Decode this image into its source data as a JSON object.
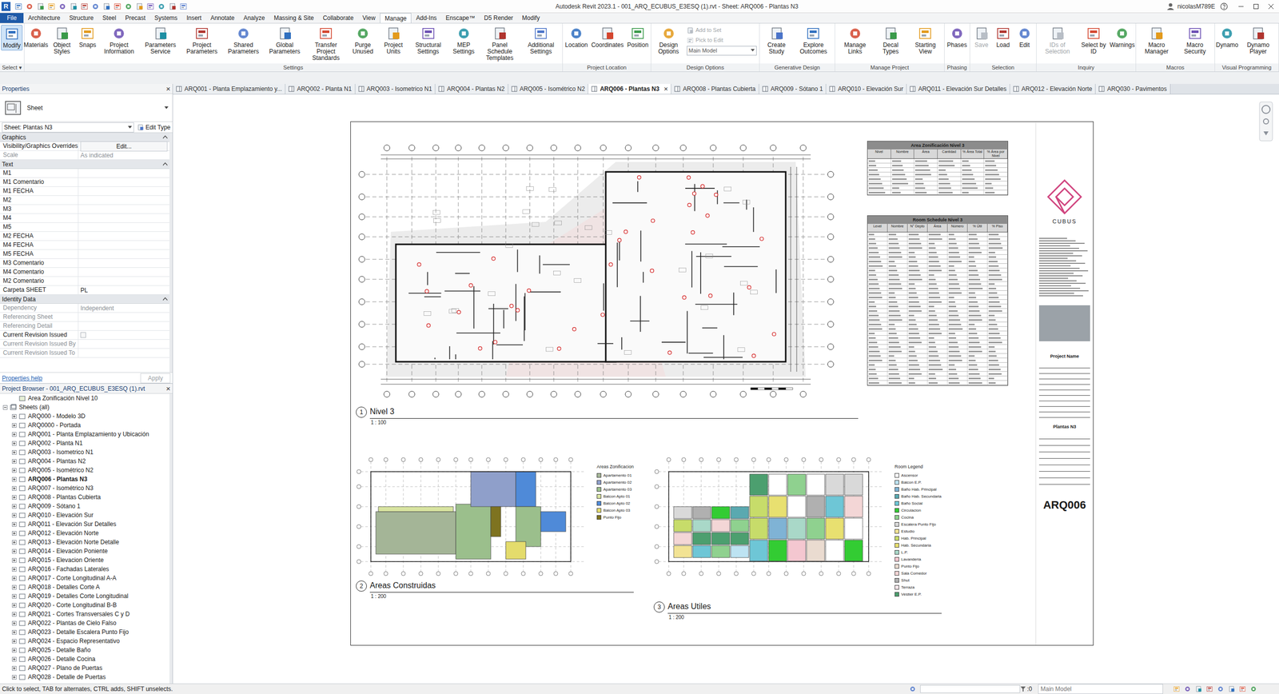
{
  "window": {
    "title": "Autodesk Revit 2023.1 - 001_ARQ_ECUBUS_E3ESQ (1).rvt - Sheet: ARQ006 - Plantas N3",
    "user": "nicolasM789E",
    "app_logo": "R"
  },
  "ribbon_tabs": [
    {
      "label": "File",
      "selected": false
    },
    {
      "label": "Architecture",
      "selected": false
    },
    {
      "label": "Structure",
      "selected": false
    },
    {
      "label": "Steel",
      "selected": false
    },
    {
      "label": "Precast",
      "selected": false
    },
    {
      "label": "Systems",
      "selected": false
    },
    {
      "label": "Insert",
      "selected": false
    },
    {
      "label": "Annotate",
      "selected": false
    },
    {
      "label": "Analyze",
      "selected": false
    },
    {
      "label": "Massing & Site",
      "selected": false
    },
    {
      "label": "Collaborate",
      "selected": false
    },
    {
      "label": "View",
      "selected": false
    },
    {
      "label": "Manage",
      "selected": true
    },
    {
      "label": "Add-Ins",
      "selected": false
    },
    {
      "label": "Enscape™",
      "selected": false
    },
    {
      "label": "D5 Render",
      "selected": false
    },
    {
      "label": "Modify",
      "selected": false
    }
  ],
  "ribbon_groups": [
    {
      "label": "Select ▾",
      "buttons": [
        {
          "label": "Modify",
          "kind": "large",
          "selected": true,
          "disabled": false
        }
      ]
    },
    {
      "label": "Settings",
      "buttons": [
        {
          "label": "Materials",
          "kind": "large",
          "selected": false,
          "disabled": false
        },
        {
          "label": "Object Styles",
          "kind": "large",
          "selected": false,
          "disabled": false
        },
        {
          "label": "Snaps",
          "kind": "large",
          "selected": false,
          "disabled": false
        },
        {
          "label": "Project Information",
          "kind": "large",
          "selected": false,
          "disabled": false
        },
        {
          "label": "Parameters Service",
          "kind": "large",
          "selected": false,
          "disabled": false
        },
        {
          "label": "Project Parameters",
          "kind": "large",
          "selected": false,
          "disabled": false
        },
        {
          "label": "Shared Parameters",
          "kind": "large",
          "selected": false,
          "disabled": false
        },
        {
          "label": "Global Parameters",
          "kind": "large",
          "selected": false,
          "disabled": false
        },
        {
          "label": "Transfer Project Standards",
          "kind": "large",
          "selected": false,
          "disabled": false
        },
        {
          "label": "Purge Unused",
          "kind": "large",
          "selected": false,
          "disabled": false
        },
        {
          "label": "Project Units",
          "kind": "large",
          "selected": false,
          "disabled": false
        },
        {
          "label": "Structural Settings",
          "kind": "large",
          "selected": false,
          "disabled": false
        },
        {
          "label": "MEP Settings",
          "kind": "large",
          "selected": false,
          "disabled": false
        },
        {
          "label": "Panel Schedule Templates",
          "kind": "large",
          "selected": false,
          "disabled": false
        },
        {
          "label": "Additional Settings",
          "kind": "large",
          "selected": false,
          "disabled": false
        }
      ]
    },
    {
      "label": "Project Location",
      "buttons": [
        {
          "label": "Location",
          "kind": "large",
          "selected": false,
          "disabled": false
        },
        {
          "label": "Coordinates",
          "kind": "large",
          "selected": false,
          "disabled": false
        },
        {
          "label": "Position",
          "kind": "large",
          "selected": false,
          "disabled": false
        }
      ]
    },
    {
      "label": "Design Options",
      "buttons": [
        {
          "label": "Design Options",
          "kind": "large",
          "selected": false,
          "disabled": false
        },
        {
          "label": "Add to Set",
          "kind": "small",
          "selected": false,
          "disabled": true
        },
        {
          "label": "Pick to Edit",
          "kind": "small",
          "selected": false,
          "disabled": true
        },
        {
          "label": "Main Model",
          "kind": "dropdown",
          "selected": false,
          "disabled": false
        }
      ]
    },
    {
      "label": "Generative Design",
      "buttons": [
        {
          "label": "Create Study",
          "kind": "large",
          "selected": false,
          "disabled": false
        },
        {
          "label": "Explore Outcomes",
          "kind": "large",
          "selected": false,
          "disabled": false
        }
      ]
    },
    {
      "label": "Manage Project",
      "buttons": [
        {
          "label": "Manage Links",
          "kind": "large",
          "selected": false,
          "disabled": false
        },
        {
          "label": "Decal Types",
          "kind": "large",
          "selected": false,
          "disabled": false
        },
        {
          "label": "Starting View",
          "kind": "large",
          "selected": false,
          "disabled": false
        }
      ]
    },
    {
      "label": "Phasing",
      "buttons": [
        {
          "label": "Phases",
          "kind": "large",
          "selected": false,
          "disabled": false
        }
      ]
    },
    {
      "label": "Selection",
      "buttons": [
        {
          "label": "Save",
          "kind": "large",
          "selected": false,
          "disabled": true
        },
        {
          "label": "Load",
          "kind": "large",
          "selected": false,
          "disabled": false
        },
        {
          "label": "Edit",
          "kind": "large",
          "selected": false,
          "disabled": false
        }
      ]
    },
    {
      "label": "Inquiry",
      "buttons": [
        {
          "label": "IDs of Selection",
          "kind": "large",
          "selected": false,
          "disabled": true
        },
        {
          "label": "Select by ID",
          "kind": "large",
          "selected": false,
          "disabled": false
        },
        {
          "label": "Warnings",
          "kind": "large",
          "selected": false,
          "disabled": false
        }
      ]
    },
    {
      "label": "Macros",
      "buttons": [
        {
          "label": "Macro Manager",
          "kind": "large",
          "selected": false,
          "disabled": false
        },
        {
          "label": "Macro Security",
          "kind": "large",
          "selected": false,
          "disabled": false
        }
      ]
    },
    {
      "label": "Visual Programming",
      "buttons": [
        {
          "label": "Dynamo",
          "kind": "large",
          "selected": false,
          "disabled": false
        },
        {
          "label": "Dynamo Player",
          "kind": "large",
          "selected": false,
          "disabled": false
        }
      ]
    }
  ],
  "view_tabs": [
    {
      "label": "ARQ001 - Planta Emplazamiento y...",
      "selected": false
    },
    {
      "label": "ARQ002 - Planta N1",
      "selected": false
    },
    {
      "label": "ARQ003 - Isometrico N1",
      "selected": false
    },
    {
      "label": "ARQ004 - Plantas N2",
      "selected": false
    },
    {
      "label": "ARQ005 - Isométrico N2",
      "selected": false
    },
    {
      "label": "ARQ006 - Plantas N3",
      "selected": true,
      "close": "×"
    },
    {
      "label": "ARQ008 - Plantas Cubierta",
      "selected": false
    },
    {
      "label": "ARQ009 - Sótano 1",
      "selected": false
    },
    {
      "label": "ARQ010 - Elevación Sur",
      "selected": false
    },
    {
      "label": "ARQ011 - Elevación Sur Detalles",
      "selected": false
    },
    {
      "label": "ARQ012 - Elevación Norte",
      "selected": false
    },
    {
      "label": "ARQ030 - Pavimentos",
      "selected": false
    }
  ],
  "properties": {
    "title": "Properties",
    "close": "×",
    "type_name": "Sheet",
    "instance": "Sheet: Plantas N3",
    "edit_type": "Edit Type",
    "sections": [
      {
        "label": "Graphics",
        "expanded": true,
        "rows": [
          {
            "name": "Visibility/Graphics Overrides",
            "value": "Edit...",
            "kind": "button"
          },
          {
            "name": "Scale",
            "value": "As indicated",
            "kind": "readonly"
          }
        ]
      },
      {
        "label": "Text",
        "expanded": true,
        "rows": [
          {
            "name": "M1",
            "value": "",
            "kind": "field"
          },
          {
            "name": "M1 Comentario",
            "value": "",
            "kind": "field"
          },
          {
            "name": "M1 FECHA",
            "value": "",
            "kind": "field"
          },
          {
            "name": "M2",
            "value": "",
            "kind": "field"
          },
          {
            "name": "M3",
            "value": "",
            "kind": "field"
          },
          {
            "name": "M4",
            "value": "",
            "kind": "field"
          },
          {
            "name": "M5",
            "value": "",
            "kind": "field"
          },
          {
            "name": "M2 FECHA",
            "value": "",
            "kind": "field"
          },
          {
            "name": "M4 FECHA",
            "value": "",
            "kind": "field"
          },
          {
            "name": "M5 FECHA",
            "value": "",
            "kind": "field"
          },
          {
            "name": "M3 Comentario",
            "value": "",
            "kind": "field"
          },
          {
            "name": "M4 Comentario",
            "value": "",
            "kind": "field"
          },
          {
            "name": "M2 Comentario",
            "value": "",
            "kind": "field"
          },
          {
            "name": "Carpeta SHEET",
            "value": "PL",
            "kind": "field"
          }
        ]
      },
      {
        "label": "Identity Data",
        "expanded": true,
        "rows": [
          {
            "name": "Dependency",
            "value": "Independent",
            "kind": "readonly"
          },
          {
            "name": "Referencing Sheet",
            "value": "",
            "kind": "readonly"
          },
          {
            "name": "Referencing Detail",
            "value": "",
            "kind": "readonly"
          },
          {
            "name": "Current Revision Issued",
            "value": "",
            "kind": "checkbox",
            "checked": false
          },
          {
            "name": "Current Revision Issued By",
            "value": "",
            "kind": "readonly"
          },
          {
            "name": "Current Revision Issued To",
            "value": "",
            "kind": "readonly"
          }
        ]
      }
    ],
    "help": "Properties help",
    "apply": "Apply"
  },
  "project_browser": {
    "title": "Project Browser - 001_ARQ_ECUBUS_E3ESQ (1).rvt",
    "close": "×",
    "items": [
      {
        "label": "Area Zonificación Nivel 10",
        "kind": "view",
        "expanded": false,
        "selected": false
      },
      {
        "label": "Sheets (all)",
        "kind": "group",
        "expanded": true,
        "selected": false
      },
      {
        "label": "ARQ000 - Modelo 3D",
        "kind": "sheet",
        "expanded": false,
        "selected": false
      },
      {
        "label": "ARQ0000 - Portada",
        "kind": "sheet",
        "expanded": false,
        "selected": false
      },
      {
        "label": "ARQ001 - Planta Emplazamiento y Ubicación",
        "kind": "sheet",
        "expanded": false,
        "selected": false
      },
      {
        "label": "ARQ002 - Planta N1",
        "kind": "sheet",
        "expanded": false,
        "selected": false
      },
      {
        "label": "ARQ003 - Isometrico N1",
        "kind": "sheet",
        "expanded": false,
        "selected": false
      },
      {
        "label": "ARQ004 - Plantas N2",
        "kind": "sheet",
        "expanded": false,
        "selected": false
      },
      {
        "label": "ARQ005 - Isométrico N2",
        "kind": "sheet",
        "expanded": false,
        "selected": false
      },
      {
        "label": "ARQ006 - Plantas N3",
        "kind": "sheet",
        "expanded": false,
        "selected": true
      },
      {
        "label": "ARQ007 - Isométrico N3",
        "kind": "sheet",
        "expanded": false,
        "selected": false
      },
      {
        "label": "ARQ008 - Plantas Cubierta",
        "kind": "sheet",
        "expanded": false,
        "selected": false
      },
      {
        "label": "ARQ009 - Sótano 1",
        "kind": "sheet",
        "expanded": false,
        "selected": false
      },
      {
        "label": "ARQ010 - Elevación Sur",
        "kind": "sheet",
        "expanded": false,
        "selected": false
      },
      {
        "label": "ARQ011 - Elevación Sur Detalles",
        "kind": "sheet",
        "expanded": false,
        "selected": false
      },
      {
        "label": "ARQ012 - Elevación Norte",
        "kind": "sheet",
        "expanded": false,
        "selected": false
      },
      {
        "label": "ARQ013 - Elevación Norte Detalle",
        "kind": "sheet",
        "expanded": false,
        "selected": false
      },
      {
        "label": "ARQ014 - Elevación Poniente",
        "kind": "sheet",
        "expanded": false,
        "selected": false
      },
      {
        "label": "ARQ015 - Elevacion Oriente",
        "kind": "sheet",
        "expanded": false,
        "selected": false
      },
      {
        "label": "ARQ016 - Fachadas Laterales",
        "kind": "sheet",
        "expanded": false,
        "selected": false
      },
      {
        "label": "ARQ017 - Corte Longitudinal A-A",
        "kind": "sheet",
        "expanded": false,
        "selected": false
      },
      {
        "label": "ARQ018 - Detalles Corte A",
        "kind": "sheet",
        "expanded": false,
        "selected": false
      },
      {
        "label": "ARQ019 - Detalles Corte Longitudinal",
        "kind": "sheet",
        "expanded": false,
        "selected": false
      },
      {
        "label": "ARQ020 - Corte Longitudinal B-B",
        "kind": "sheet",
        "expanded": false,
        "selected": false
      },
      {
        "label": "ARQ021 - Cortes Transversales C y D",
        "kind": "sheet",
        "expanded": false,
        "selected": false
      },
      {
        "label": "ARQ022 - Plantas de Cielo Falso",
        "kind": "sheet",
        "expanded": false,
        "selected": false
      },
      {
        "label": "ARQ023 - Detalle Escalera Punto Fijo",
        "kind": "sheet",
        "expanded": false,
        "selected": false
      },
      {
        "label": "ARQ024 - Espacio Representativo",
        "kind": "sheet",
        "expanded": false,
        "selected": false
      },
      {
        "label": "ARQ025 - Detalle Baño",
        "kind": "sheet",
        "expanded": false,
        "selected": false
      },
      {
        "label": "ARQ026 - Detalle Cocina",
        "kind": "sheet",
        "expanded": false,
        "selected": false
      },
      {
        "label": "ARQ027 - Plano de Puertas",
        "kind": "sheet",
        "expanded": false,
        "selected": false
      },
      {
        "label": "ARQ028 - Detalle de Puertas",
        "kind": "sheet",
        "expanded": false,
        "selected": false
      }
    ]
  },
  "sheet": {
    "viewports": [
      {
        "number": "1",
        "title": "Nivel 3",
        "scale": "1 : 100"
      },
      {
        "number": "2",
        "title": "Areas Construidas",
        "scale": "1 : 200"
      },
      {
        "number": "3",
        "title": "Areas Utiles",
        "scale": "1 : 200"
      }
    ],
    "zone_legend": {
      "title": "Areas Zonificacion",
      "items": [
        {
          "label": "Apartamento 01",
          "color": "#a4b597"
        },
        {
          "label": "Apartamento 02",
          "color": "#8f9fca"
        },
        {
          "label": "Apartamento 03",
          "color": "#9bbf8c"
        },
        {
          "label": "Balcon Apto 01",
          "color": "#d8e4a0"
        },
        {
          "label": "Balcon Apto 02",
          "color": "#4f8ad8"
        },
        {
          "label": "Balcon Apto 03",
          "color": "#e4dc6c"
        },
        {
          "label": "Punto Fijo",
          "color": "#7e7320"
        }
      ]
    },
    "room_legend": {
      "title": "Room Legend",
      "items": [
        {
          "label": "Ascensor",
          "color": "#ffffff"
        },
        {
          "label": "Balcon E.P.",
          "color": "#bde3f2"
        },
        {
          "label": "Baño Hab. Principal",
          "color": "#7fb3d5"
        },
        {
          "label": "Baño Hab. Secundaria",
          "color": "#5aa9b0"
        },
        {
          "label": "Baño Social",
          "color": "#6ec6d6"
        },
        {
          "label": "Circulacion",
          "color": "#33cc33"
        },
        {
          "label": "Cocina",
          "color": "#8fd18f"
        },
        {
          "label": "Escalera Punto Fijo",
          "color": "#d9d9d9"
        },
        {
          "label": "Estudio",
          "color": "#f2e394"
        },
        {
          "label": "Hab. Principal",
          "color": "#c7dc6a"
        },
        {
          "label": "Hab. Secundaria",
          "color": "#e8e070"
        },
        {
          "label": "L.P.",
          "color": "#a9d8c8"
        },
        {
          "label": "Lavanderia",
          "color": "#f4c7d0"
        },
        {
          "label": "Punto Fijo",
          "color": "#eadbd0"
        },
        {
          "label": "Sala Comedor",
          "color": "#f3d6d6"
        },
        {
          "label": "Shut",
          "color": "#b0b0b0"
        },
        {
          "label": "Terraza",
          "color": "#f7e6ea"
        },
        {
          "label": "Vestier E.P.",
          "color": "#4c9f6f"
        }
      ]
    },
    "schedules": [
      {
        "title": "Area Zonificación Nivel 3",
        "columns": [
          "Nivel",
          "Nombre",
          "Área",
          "Cantidad",
          "% Área Total",
          "% Área por Nivel"
        ]
      },
      {
        "title": "Room Schedule Nivel 3",
        "columns": [
          "Level",
          "Nombre",
          "N° Depto",
          "Área",
          "Número",
          "% Útil",
          "% Piso"
        ]
      }
    ],
    "title_block": {
      "logo_text": "CUBUS",
      "project_name": "Project Name",
      "sheet_name": "Plantas N3",
      "sheet_number": "ARQ006"
    }
  },
  "status_bar": {
    "hint": "Click to select, TAB for alternates, CTRL adds, SHIFT unselects.",
    "selection_count": ":0",
    "model": "Main Model"
  }
}
